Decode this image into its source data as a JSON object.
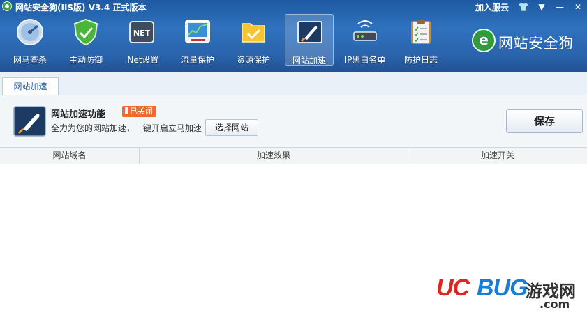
{
  "titlebar": {
    "title": "网站安全狗(IIS版) V3.4 正式版本",
    "join_cloud": "加入服云",
    "buttons": [
      "shirt-icon",
      "menu-icon",
      "minimize-icon",
      "close-icon"
    ],
    "glyphs": {
      "skin": "👕",
      "menu": "▼",
      "minimize": "—",
      "close": "✕"
    }
  },
  "toolbar": {
    "items": [
      {
        "label": "网马查杀",
        "icon": "scan-icon"
      },
      {
        "label": "主动防御",
        "icon": "shield-icon"
      },
      {
        "label": ".Net设置",
        "icon": "net-icon"
      },
      {
        "label": "流量保护",
        "icon": "traffic-icon"
      },
      {
        "label": "资源保护",
        "icon": "folder-icon"
      },
      {
        "label": "网站加速",
        "icon": "rocket-icon",
        "active": true
      },
      {
        "label": "IP黑白名单",
        "icon": "router-icon"
      },
      {
        "label": "防护日志",
        "icon": "clipboard-icon"
      }
    ]
  },
  "brand": {
    "badge": "e",
    "text": "网站安全狗"
  },
  "tabs": [
    {
      "label": "网站加速",
      "active": true
    }
  ],
  "feature": {
    "title": "网站加速功能",
    "status": "已关闭",
    "description": "全力为您的网站加速，一键开启立马加速",
    "select_button": "选择网站",
    "save_button": "保存"
  },
  "table": {
    "columns": [
      "网站域名",
      "加速效果",
      "加速开关"
    ],
    "rows": []
  },
  "watermark": {
    "uc": "UC",
    "bug": "BUG",
    "site": "游戏网",
    "com": ".com"
  },
  "colors": {
    "header_top": "#1e5aa3",
    "header_bottom": "#215293",
    "status_badge": "#ef6b2c",
    "tab_text": "#1f5ea8",
    "watermark_red": "#e0251c",
    "watermark_blue": "#1b7cd4"
  }
}
